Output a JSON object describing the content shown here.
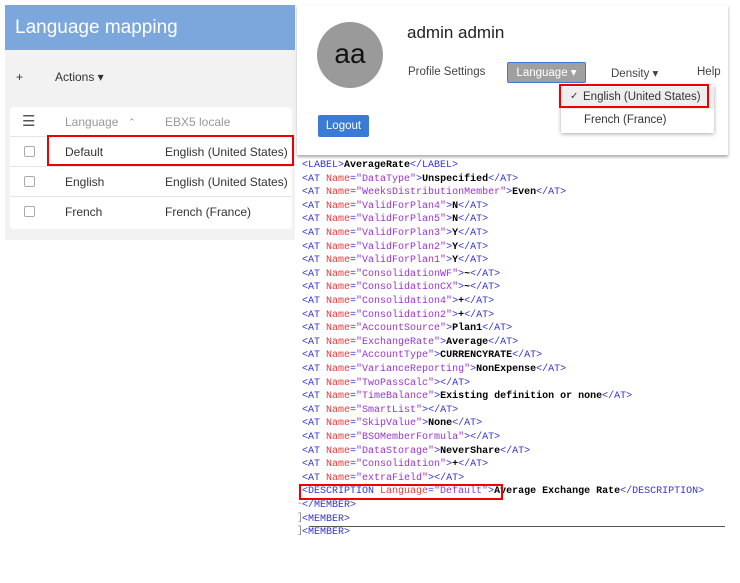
{
  "left_panel": {
    "title": "Language mapping",
    "add_label": "+",
    "actions_label": "Actions ▾",
    "table": {
      "columns": [
        "Language",
        "EBX5 locale"
      ],
      "sort_indicator": "⌃",
      "rows": [
        {
          "language": "Default",
          "locale": "English (United States)",
          "highlighted": true
        },
        {
          "language": "English",
          "locale": "English (United States)"
        },
        {
          "language": "French",
          "locale": "French (France)"
        }
      ]
    }
  },
  "profile": {
    "avatar_initials": "aa",
    "user_name": "admin admin",
    "nav": {
      "profile_settings": "Profile Settings",
      "language": "Language ▾",
      "density": "Density ▾",
      "help": "Help"
    },
    "language_options": [
      {
        "label": "English (United States)",
        "checked": true,
        "check": "✓"
      },
      {
        "label": "French (France)",
        "checked": false
      }
    ],
    "logout_label": "Logout",
    "accent_color": "#3a7bd5"
  },
  "code": {
    "lines": [
      [
        [
          "tag",
          "<LABEL>"
        ],
        [
          "tx",
          "AverageRate"
        ],
        [
          "tag",
          "</LABEL>"
        ]
      ],
      [
        [
          "tag",
          "<AT "
        ],
        [
          "an",
          "Name"
        ],
        [
          "tag",
          "="
        ],
        [
          "av",
          "\"DataType\""
        ],
        [
          "tag",
          ">"
        ],
        [
          "tx",
          "Unspecified"
        ],
        [
          "tag",
          "</AT>"
        ]
      ],
      [
        [
          "tag",
          "<AT "
        ],
        [
          "an",
          "Name"
        ],
        [
          "tag",
          "="
        ],
        [
          "av",
          "\"WeeksDistributionMember\""
        ],
        [
          "tag",
          ">"
        ],
        [
          "tx",
          "Even"
        ],
        [
          "tag",
          "</AT>"
        ]
      ],
      [
        [
          "tag",
          "<AT "
        ],
        [
          "an",
          "Name"
        ],
        [
          "tag",
          "="
        ],
        [
          "av",
          "\"ValidForPlan4\""
        ],
        [
          "tag",
          ">"
        ],
        [
          "tx",
          "N"
        ],
        [
          "tag",
          "</AT>"
        ]
      ],
      [
        [
          "tag",
          "<AT "
        ],
        [
          "an",
          "Name"
        ],
        [
          "tag",
          "="
        ],
        [
          "av",
          "\"ValidForPlan5\""
        ],
        [
          "tag",
          ">"
        ],
        [
          "tx",
          "N"
        ],
        [
          "tag",
          "</AT>"
        ]
      ],
      [
        [
          "tag",
          "<AT "
        ],
        [
          "an",
          "Name"
        ],
        [
          "tag",
          "="
        ],
        [
          "av",
          "\"ValidForPlan3\""
        ],
        [
          "tag",
          ">"
        ],
        [
          "tx",
          "Y"
        ],
        [
          "tag",
          "</AT>"
        ]
      ],
      [
        [
          "tag",
          "<AT "
        ],
        [
          "an",
          "Name"
        ],
        [
          "tag",
          "="
        ],
        [
          "av",
          "\"ValidForPlan2\""
        ],
        [
          "tag",
          ">"
        ],
        [
          "tx",
          "Y"
        ],
        [
          "tag",
          "</AT>"
        ]
      ],
      [
        [
          "tag",
          "<AT "
        ],
        [
          "an",
          "Name"
        ],
        [
          "tag",
          "="
        ],
        [
          "av",
          "\"ValidForPlan1\""
        ],
        [
          "tag",
          ">"
        ],
        [
          "tx",
          "Y"
        ],
        [
          "tag",
          "</AT>"
        ]
      ],
      [
        [
          "tag",
          "<AT "
        ],
        [
          "an",
          "Name"
        ],
        [
          "tag",
          "="
        ],
        [
          "av",
          "\"ConsolidationWF\""
        ],
        [
          "tag",
          ">"
        ],
        [
          "tx",
          "~"
        ],
        [
          "tag",
          "</AT>"
        ]
      ],
      [
        [
          "tag",
          "<AT "
        ],
        [
          "an",
          "Name"
        ],
        [
          "tag",
          "="
        ],
        [
          "av",
          "\"ConsolidationCX\""
        ],
        [
          "tag",
          ">"
        ],
        [
          "tx",
          "~"
        ],
        [
          "tag",
          "</AT>"
        ]
      ],
      [
        [
          "tag",
          "<AT "
        ],
        [
          "an",
          "Name"
        ],
        [
          "tag",
          "="
        ],
        [
          "av",
          "\"Consolidation4\""
        ],
        [
          "tag",
          ">"
        ],
        [
          "tx",
          "+"
        ],
        [
          "tag",
          "</AT>"
        ]
      ],
      [
        [
          "tag",
          "<AT "
        ],
        [
          "an",
          "Name"
        ],
        [
          "tag",
          "="
        ],
        [
          "av",
          "\"Consolidation2\""
        ],
        [
          "tag",
          ">"
        ],
        [
          "tx",
          "+"
        ],
        [
          "tag",
          "</AT>"
        ]
      ],
      [
        [
          "tag",
          "<AT "
        ],
        [
          "an",
          "Name"
        ],
        [
          "tag",
          "="
        ],
        [
          "av",
          "\"AccountSource\""
        ],
        [
          "tag",
          ">"
        ],
        [
          "tx",
          "Plan1"
        ],
        [
          "tag",
          "</AT>"
        ]
      ],
      [
        [
          "tag",
          "<AT "
        ],
        [
          "an",
          "Name"
        ],
        [
          "tag",
          "="
        ],
        [
          "av",
          "\"ExchangeRate\""
        ],
        [
          "tag",
          ">"
        ],
        [
          "tx",
          "Average"
        ],
        [
          "tag",
          "</AT>"
        ]
      ],
      [
        [
          "tag",
          "<AT "
        ],
        [
          "an",
          "Name"
        ],
        [
          "tag",
          "="
        ],
        [
          "av",
          "\"AccountType\""
        ],
        [
          "tag",
          ">"
        ],
        [
          "tx",
          "CURRENCYRATE"
        ],
        [
          "tag",
          "</AT>"
        ]
      ],
      [
        [
          "tag",
          "<AT "
        ],
        [
          "an",
          "Name"
        ],
        [
          "tag",
          "="
        ],
        [
          "av",
          "\"VarianceReporting\""
        ],
        [
          "tag",
          ">"
        ],
        [
          "tx",
          "NonExpense"
        ],
        [
          "tag",
          "</AT>"
        ]
      ],
      [
        [
          "tag",
          "<AT "
        ],
        [
          "an",
          "Name"
        ],
        [
          "tag",
          "="
        ],
        [
          "av",
          "\"TwoPassCalc\""
        ],
        [
          "tag",
          "></AT>"
        ]
      ],
      [
        [
          "tag",
          "<AT "
        ],
        [
          "an",
          "Name"
        ],
        [
          "tag",
          "="
        ],
        [
          "av",
          "\"TimeBalance\""
        ],
        [
          "tag",
          ">"
        ],
        [
          "tx",
          "Existing definition or none"
        ],
        [
          "tag",
          "</AT>"
        ]
      ],
      [
        [
          "tag",
          "<AT "
        ],
        [
          "an",
          "Name"
        ],
        [
          "tag",
          "="
        ],
        [
          "av",
          "\"SmartList\""
        ],
        [
          "tag",
          "></AT>"
        ]
      ],
      [
        [
          "tag",
          "<AT "
        ],
        [
          "an",
          "Name"
        ],
        [
          "tag",
          "="
        ],
        [
          "av",
          "\"SkipValue\""
        ],
        [
          "tag",
          ">"
        ],
        [
          "tx",
          "None"
        ],
        [
          "tag",
          "</AT>"
        ]
      ],
      [
        [
          "tag",
          "<AT "
        ],
        [
          "an",
          "Name"
        ],
        [
          "tag",
          "="
        ],
        [
          "av",
          "\"BSOMemberFormula\""
        ],
        [
          "tag",
          "></AT>"
        ]
      ],
      [
        [
          "tag",
          "<AT "
        ],
        [
          "an",
          "Name"
        ],
        [
          "tag",
          "="
        ],
        [
          "av",
          "\"DataStorage\""
        ],
        [
          "tag",
          ">"
        ],
        [
          "tx",
          "NeverShare"
        ],
        [
          "tag",
          "</AT>"
        ]
      ],
      [
        [
          "tag",
          "<AT "
        ],
        [
          "an",
          "Name"
        ],
        [
          "tag",
          "="
        ],
        [
          "av",
          "\"Consolidation\""
        ],
        [
          "tag",
          ">"
        ],
        [
          "tx",
          "+"
        ],
        [
          "tag",
          "</AT>"
        ]
      ],
      [
        [
          "tag",
          "<AT "
        ],
        [
          "an",
          "Name"
        ],
        [
          "tag",
          "="
        ],
        [
          "av",
          "\"extraField\""
        ],
        [
          "tag",
          "></AT>"
        ]
      ],
      [
        [
          "tag",
          "<DESCRIPTION "
        ],
        [
          "an",
          "Language"
        ],
        [
          "tag",
          "="
        ],
        [
          "av",
          "\"Default\""
        ],
        [
          "tag",
          ">"
        ],
        [
          "tx",
          "Average Exchange Rate"
        ],
        [
          "tag",
          "</DESCRIPTION>"
        ]
      ],
      [
        [
          "tag",
          "</MEMBER>"
        ]
      ],
      [
        [
          "tag",
          "<MEMBER>"
        ]
      ],
      [
        [
          "tag",
          "<MEMBER>"
        ]
      ]
    ],
    "gutter_markers": [
      "-",
      "]",
      "]"
    ]
  }
}
